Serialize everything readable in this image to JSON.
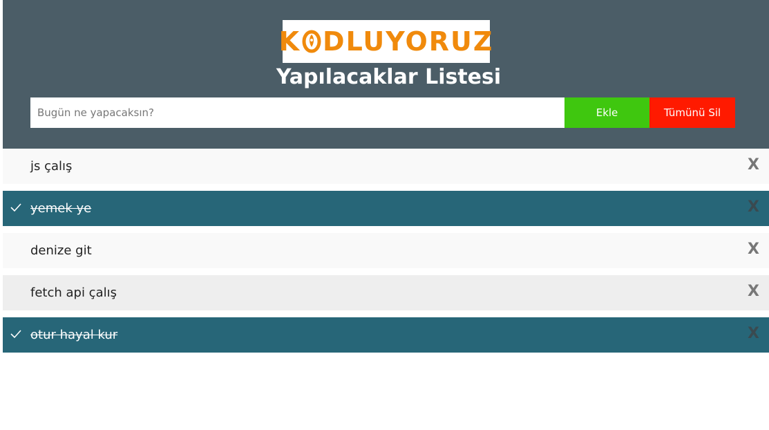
{
  "header": {
    "logo_text_left": "K",
    "logo_text_right": "DLUYORUZ",
    "title": "Yapılacaklar Listesi",
    "input_placeholder": "Bugün ne yapacaksın?",
    "input_value": "",
    "add_label": "Ekle",
    "clear_label": "Tümünü Sil"
  },
  "colors": {
    "header_bg": "#4b5d67",
    "logo": "#f08a0c",
    "add_button": "#3fc70f",
    "clear_button": "#ff1a00",
    "done_row": "#276678"
  },
  "todos": [
    {
      "text": "js çalış",
      "done": false,
      "close": "X"
    },
    {
      "text": "yemek ye",
      "done": true,
      "close": "X"
    },
    {
      "text": "denize git",
      "done": false,
      "close": "X"
    },
    {
      "text": "fetch api çalış",
      "done": false,
      "close": "X"
    },
    {
      "text": "otur hayal kur",
      "done": true,
      "close": "X"
    }
  ]
}
